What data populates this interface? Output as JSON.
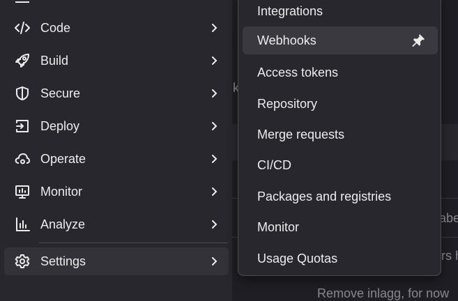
{
  "sidebar": {
    "items": [
      {
        "label": "Code",
        "icon": "code-icon"
      },
      {
        "label": "Build",
        "icon": "rocket-icon"
      },
      {
        "label": "Secure",
        "icon": "shield-icon"
      },
      {
        "label": "Deploy",
        "icon": "deploy-icon"
      },
      {
        "label": "Operate",
        "icon": "cloud-gear-icon"
      },
      {
        "label": "Monitor",
        "icon": "monitor-icon"
      },
      {
        "label": "Analyze",
        "icon": "chart-icon"
      },
      {
        "label": "Settings",
        "icon": "gear-icon",
        "active": true
      }
    ]
  },
  "settings_menu": {
    "items": [
      {
        "label": "Integrations"
      },
      {
        "label": "Webhooks",
        "hovered": true,
        "pin_icon": "pin-icon"
      },
      {
        "label": "Access tokens"
      },
      {
        "label": "Repository"
      },
      {
        "label": "Merge requests"
      },
      {
        "label": "CI/CD"
      },
      {
        "label": "Packages and registries"
      },
      {
        "label": "Monitor"
      },
      {
        "label": "Usage Quotas"
      }
    ]
  },
  "background": {
    "fragment_k": "k",
    "fragment_abe": "abe",
    "fragment_rs_h": "rs h",
    "fragment_remove": "Remove inlagg, for now"
  },
  "colors": {
    "sidebar_bg": "#28272d",
    "page_bg": "#1f1e24",
    "text": "#ececef",
    "active_bg": "#333238",
    "hover_bg": "#3a393f"
  }
}
